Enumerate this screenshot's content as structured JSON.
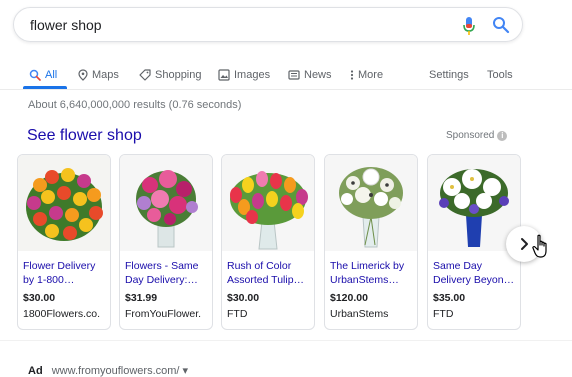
{
  "search": {
    "query": "flower shop"
  },
  "tabs": [
    {
      "label": "All",
      "icon": "search-icon"
    },
    {
      "label": "Maps",
      "icon": "map-pin-icon"
    },
    {
      "label": "Shopping",
      "icon": "tag-icon"
    },
    {
      "label": "Images",
      "icon": "image-icon"
    },
    {
      "label": "News",
      "icon": "news-icon"
    },
    {
      "label": "More",
      "icon": "more-vert-icon"
    }
  ],
  "tools": {
    "settings": "Settings",
    "tools": "Tools"
  },
  "results": {
    "stats": "About 6,640,000,000 results (0.76 seconds)"
  },
  "shopping": {
    "title": "See flower shop",
    "sponsored": "Sponsored",
    "products": [
      {
        "title": "Flower Delivery by 1-800…",
        "price": "$30.00",
        "merchant": "1800Flowers.co."
      },
      {
        "title": "Flowers - Same Day Delivery:…",
        "price": "$31.99",
        "merchant": "FromYouFlower."
      },
      {
        "title": "Rush of Color Assorted Tulip…",
        "price": "$30.00",
        "merchant": "FTD"
      },
      {
        "title": "The Limerick by UrbanStems…",
        "price": "$120.00",
        "merchant": "UrbanStems"
      },
      {
        "title": "Same Day Delivery Beyon…",
        "price": "$35.00",
        "merchant": "FTD"
      }
    ]
  },
  "ad": {
    "label": "Ad",
    "url": "www.fromyouflowers.com/ ▾"
  },
  "colors": {
    "link": "#1a0dab",
    "accent": "#1a73e8",
    "muted": "#70757a"
  }
}
